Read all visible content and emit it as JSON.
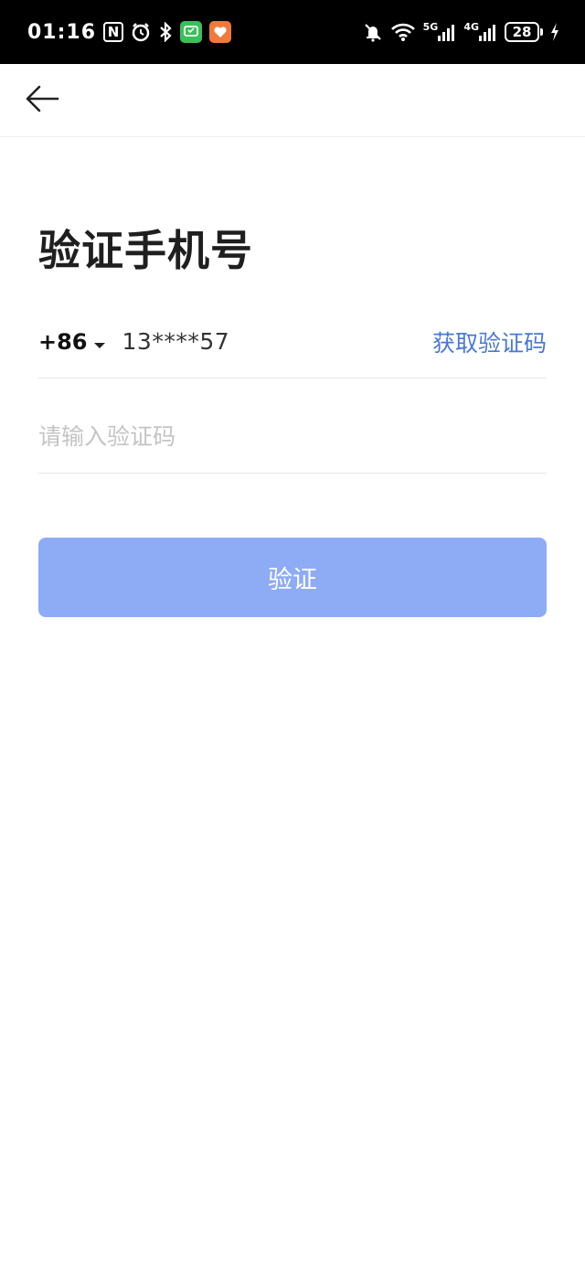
{
  "status_bar": {
    "time": "01:16",
    "nfc_label": "N",
    "net_5g": "5G",
    "net_4g": "4G",
    "battery_level": "28",
    "icons": [
      "nfc-icon",
      "alarm-icon",
      "bluetooth-icon",
      "app-notification-icon",
      "health-app-icon",
      "mute-icon",
      "wifi-icon",
      "signal-5g-icon",
      "signal-4g-icon",
      "battery-icon",
      "charging-icon"
    ]
  },
  "nav": {
    "back_icon": "arrow-left-icon"
  },
  "title": "验证手机号",
  "phone": {
    "country_code": "+86",
    "number": "13****57",
    "get_code_label": "获取验证码"
  },
  "code_field": {
    "value": "",
    "placeholder": "请输入验证码"
  },
  "verify_button_label": "验证",
  "colors": {
    "accent": "#4a78d6",
    "button_disabled": "#8eabf5",
    "title": "#1f1f1f"
  }
}
